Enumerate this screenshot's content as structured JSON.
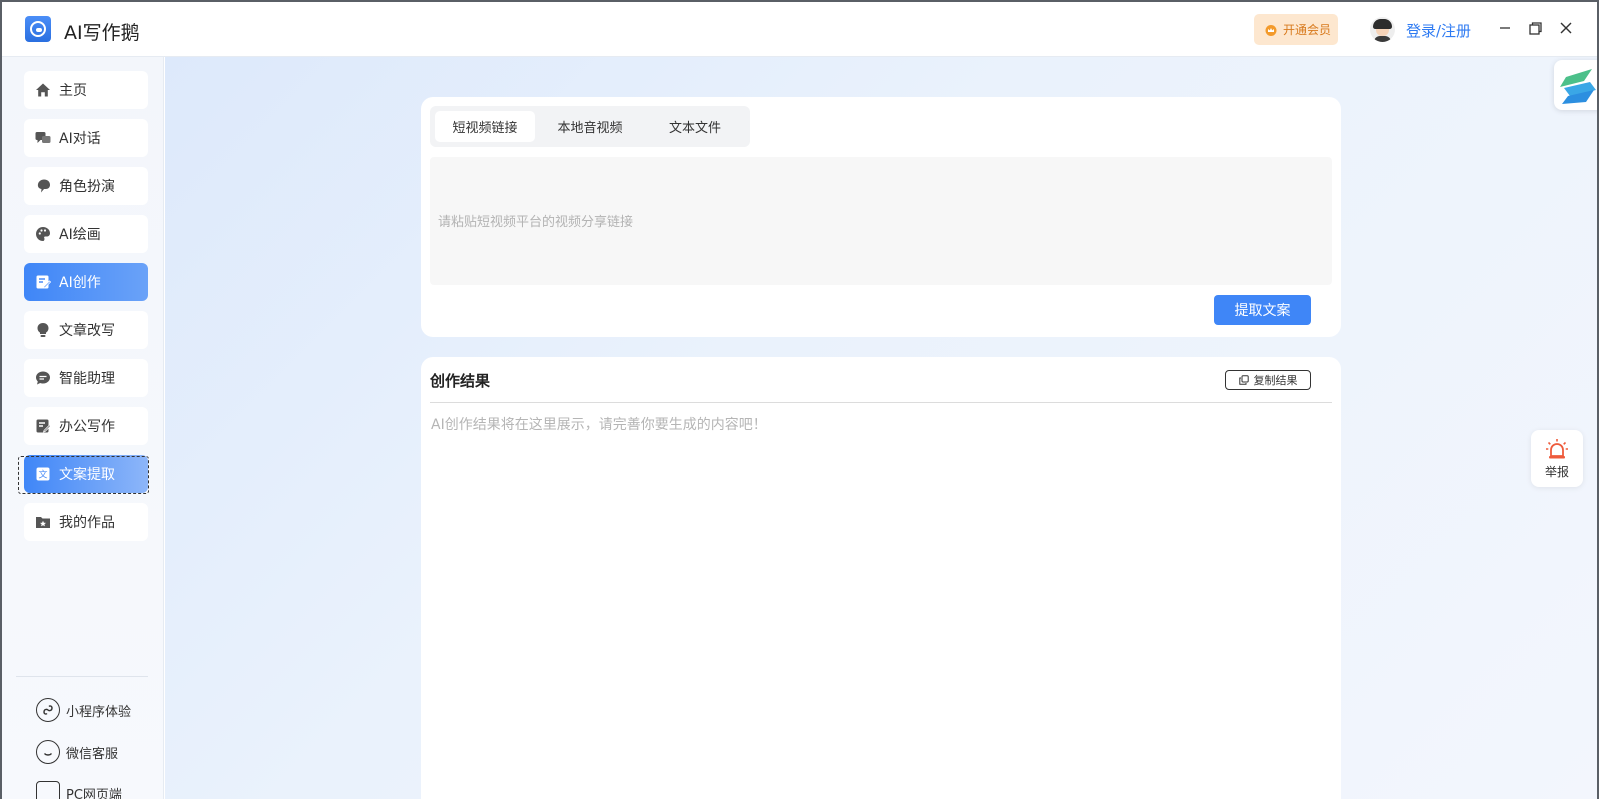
{
  "app": {
    "title": "AI写作鹅"
  },
  "header": {
    "vip_label": "开通会员",
    "login_label": "登录/注册"
  },
  "sidebar": {
    "items": [
      {
        "label": "主页",
        "icon": "home-icon"
      },
      {
        "label": "AI对话",
        "icon": "chat-icon"
      },
      {
        "label": "角色扮演",
        "icon": "role-play-icon"
      },
      {
        "label": "AI绘画",
        "icon": "palette-icon"
      },
      {
        "label": "AI创作",
        "icon": "edit-icon"
      },
      {
        "label": "文章改写",
        "icon": "lightbulb-icon"
      },
      {
        "label": "智能助理",
        "icon": "assistant-icon"
      },
      {
        "label": "办公写作",
        "icon": "document-edit-icon"
      },
      {
        "label": "文案提取",
        "icon": "translate-icon"
      },
      {
        "label": "我的作品",
        "icon": "folder-star-icon"
      }
    ],
    "bottom_links": [
      {
        "label": "小程序体验",
        "icon": "mini-program-icon"
      },
      {
        "label": "微信客服",
        "icon": "wechat-service-icon"
      },
      {
        "label": "PC网页端",
        "icon": "pc-web-icon"
      }
    ]
  },
  "extract": {
    "tabs": [
      "短视频链接",
      "本地音视频",
      "文本文件"
    ],
    "active_tab": "短视频链接",
    "input_placeholder": "请粘贴短视频平台的视频分享链接",
    "input_value": "",
    "submit_label": "提取文案"
  },
  "result": {
    "title": "创作结果",
    "copy_label": "复制结果",
    "placeholder": "AI创作结果将在这里展示，请完善你要生成的内容吧！"
  },
  "floating": {
    "report_label": "举报"
  },
  "colors": {
    "accent": "#3f86f7",
    "link": "#2f7bf2",
    "vip_bg": "#fde7cf",
    "vip_text": "#d87a1d"
  }
}
